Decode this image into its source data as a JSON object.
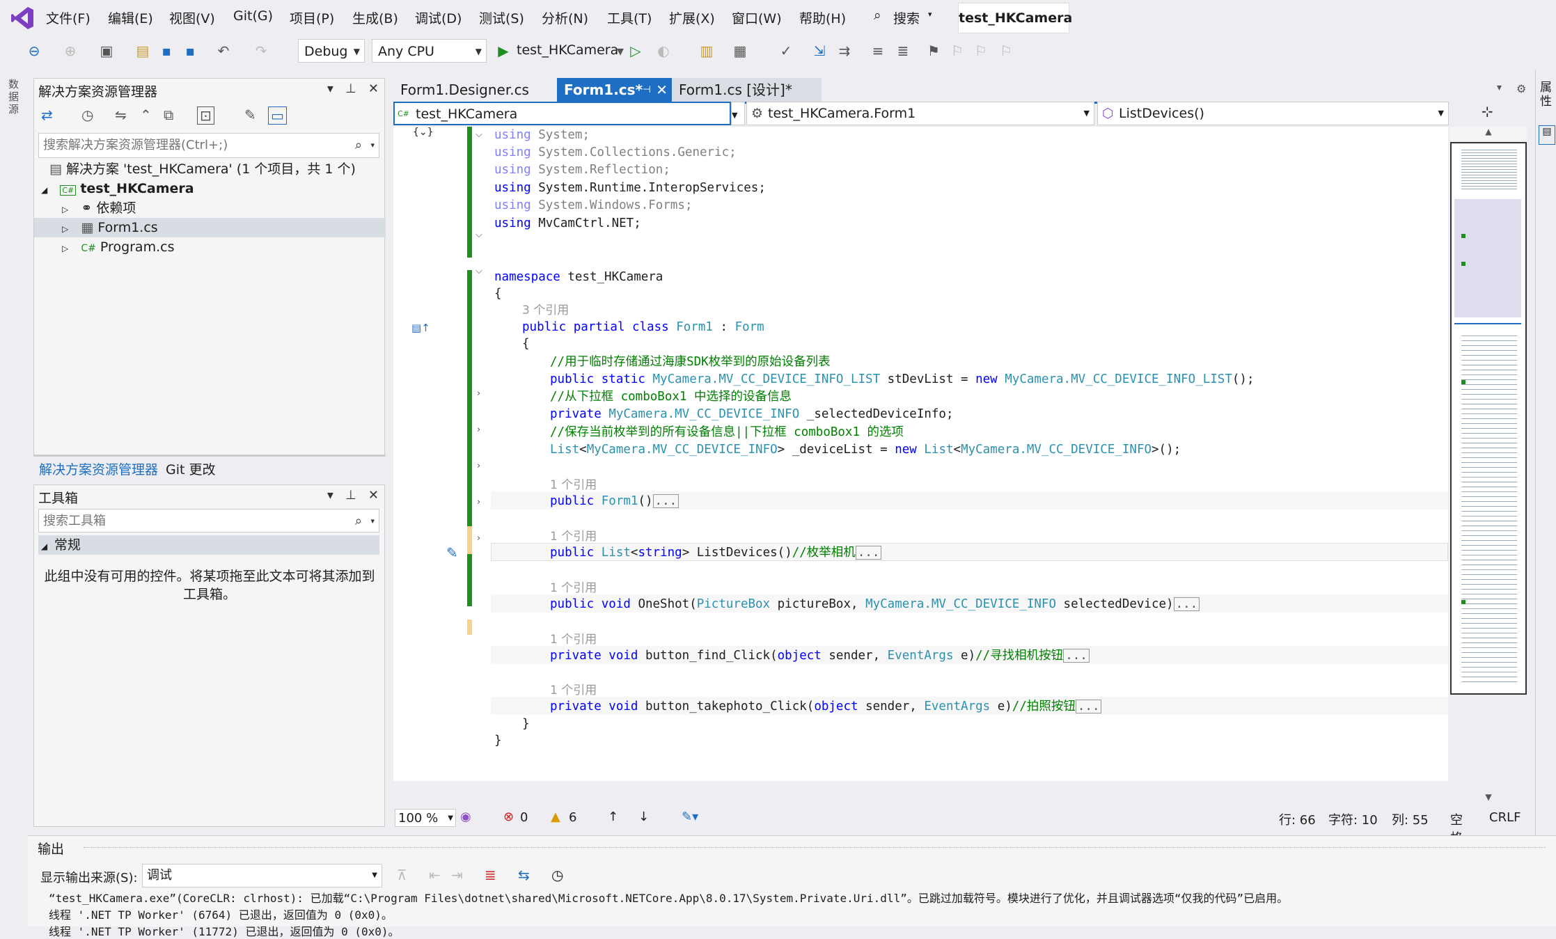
{
  "menu": {
    "items": [
      "文件(F)",
      "编辑(E)",
      "视图(V)",
      "Git(G)",
      "项目(P)",
      "生成(B)",
      "调试(D)",
      "测试(S)",
      "分析(N)",
      "工具(T)",
      "扩展(X)",
      "窗口(W)",
      "帮助(H)"
    ],
    "search_label": "搜索",
    "solution_title": "test_HKCamera"
  },
  "toolbar": {
    "config": "Debug",
    "platform": "Any CPU",
    "run_target": "test_HKCamera"
  },
  "left_vertical_tab": "数据源",
  "solution_explorer": {
    "title": "解决方案资源管理器",
    "search_placeholder": "搜索解决方案资源管理器(Ctrl+;)",
    "solution_label": "解决方案 'test_HKCamera' (1 个项目，共 1 个)",
    "project": "test_HKCamera",
    "items": [
      "依赖项",
      "Form1.cs",
      "Program.cs"
    ],
    "bottom_tabs": [
      "解决方案资源管理器",
      "Git 更改"
    ]
  },
  "toolbox": {
    "title": "工具箱",
    "search_placeholder": "搜索工具箱",
    "group": "常规",
    "empty_text": "此组中没有可用的控件。将某项拖至此文本可将其添加到工具箱。"
  },
  "editor": {
    "tabs": [
      "Form1.Designer.cs",
      "Form1.cs*",
      "Form1.cs [设计]*"
    ],
    "active_tab": "Form1.cs*",
    "nav_project": "test_HKCamera",
    "nav_class": "test_HKCamera.Form1",
    "nav_member": "ListDevices()",
    "usings": [
      "System",
      "System.Collections.Generic",
      "System.Reflection",
      "System.Runtime.InteropServices",
      "System.Windows.Forms",
      "MvCamCtrl.NET"
    ],
    "ref3": "3 个引用",
    "ref1": "1 个引用",
    "namespace": "test_HKCamera",
    "comment1": "//用于临时存储通过海康SDK枚举到的原始设备列表",
    "comment2": "//从下拉框 comboBox1 中选择的设备信息",
    "comment3": "//保存当前枚举到的所有设备信息||下拉框 comboBox1 的选项",
    "comment_list": "//枚举相机",
    "comment_find": "//寻找相机按钮",
    "comment_photo": "//拍照按钮"
  },
  "editor_status": {
    "zoom": "100 %",
    "errors": "0",
    "warnings": "6",
    "line": "行: 66",
    "char": "字符: 10",
    "col": "列: 55",
    "space": "空格",
    "eol": "CRLF"
  },
  "output": {
    "title": "输出",
    "source_label": "显示输出来源(S):",
    "source_value": "调试",
    "lines": [
      "“test_HKCamera.exe”(CoreCLR: clrhost): 已加载“C:\\Program Files\\dotnet\\shared\\Microsoft.NETCore.App\\8.0.17\\System.Private.Uri.dll”。已跳过加载符号。模块进行了优化，并且调试器选项“仅我的代码”已启用。",
      "线程 '.NET TP Worker' (6764) 已退出，返回值为 0 (0x0)。",
      "线程 '.NET TP Worker' (11772) 已退出，返回值为 0 (0x0)。"
    ]
  },
  "right_strip": "属性"
}
